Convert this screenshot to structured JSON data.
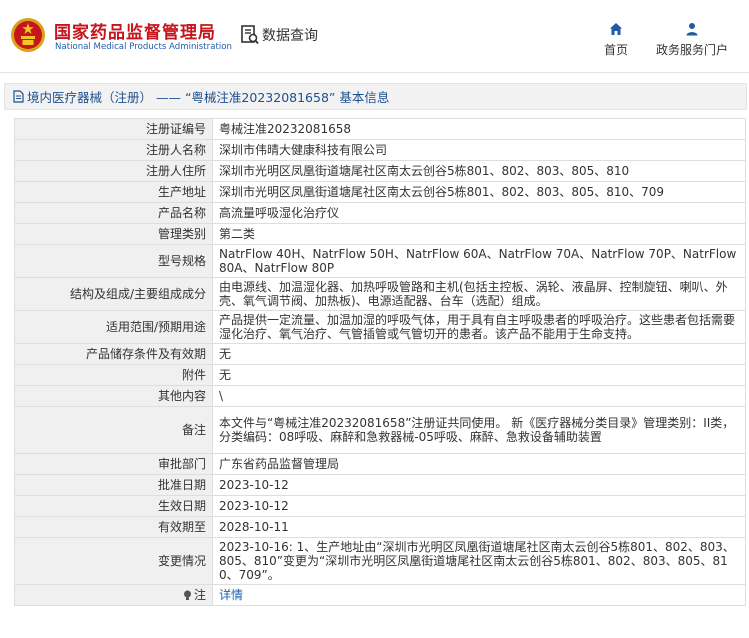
{
  "header": {
    "brand_cn": "国家药品监督管理局",
    "brand_en": "National Medical Products Administration",
    "query_label": "数据查询",
    "nav_home": "首页",
    "nav_service": "政务服务门户"
  },
  "breadcrumb": {
    "text": "境内医疗器械（注册） —— “粤械注准20232081658” 基本信息"
  },
  "record": {
    "rows": [
      {
        "label": "注册证编号",
        "value": "粤械注准20232081658"
      },
      {
        "label": "注册人名称",
        "value": "深圳市伟晴大健康科技有限公司"
      },
      {
        "label": "注册人住所",
        "value": "深圳市光明区凤凰街道塘尾社区南太云创谷5栋801、802、803、805、810"
      },
      {
        "label": "生产地址",
        "value": "深圳市光明区凤凰街道塘尾社区南太云创谷5栋801、802、803、805、810、709"
      },
      {
        "label": "产品名称",
        "value": "高流量呼吸湿化治疗仪"
      },
      {
        "label": "管理类别",
        "value": "第二类"
      },
      {
        "label": "型号规格",
        "value": "NatrFlow 40H、NatrFlow 50H、NatrFlow 60A、NatrFlow 70A、NatrFlow 70P、NatrFlow 80A、NatrFlow 80P"
      },
      {
        "label": "结构及组成/主要组成成分",
        "value": "由电源线、加温湿化器、加热呼吸管路和主机(包括主控板、涡轮、液晶屏、控制旋钮、喇叭、外壳、氧气调节阀、加热板)、电源适配器、台车（选配）组成。"
      },
      {
        "label": "适用范围/预期用途",
        "value": "产品提供一定流量、加温加湿的呼吸气体，用于具有自主呼吸患者的呼吸治疗。这些患者包括需要湿化治疗、氧气治疗、气管插管或气管切开的患者。该产品不能用于生命支持。"
      },
      {
        "label": "产品储存条件及有效期",
        "value": "无"
      },
      {
        "label": "附件",
        "value": "无"
      },
      {
        "label": "其他内容",
        "value": "\\"
      },
      {
        "label": "备注",
        "value": "本文件与“粤械注准20232081658”注册证共同使用。 新《医疗器械分类目录》管理类别：II类，分类编码：08呼吸、麻醉和急救器械-05呼吸、麻醉、急救设备辅助装置"
      },
      {
        "label": "审批部门",
        "value": "广东省药品监督管理局"
      },
      {
        "label": "批准日期",
        "value": "2023-10-12"
      },
      {
        "label": "生效日期",
        "value": "2023-10-12"
      },
      {
        "label": "有效期至",
        "value": "2028-10-11"
      },
      {
        "label": "变更情况",
        "value": "2023-10-16: 1、生产地址由“深圳市光明区凤凰街道塘尾社区南太云创谷5栋801、802、803、805、810”变更为“深圳市光明区凤凰街道塘尾社区南太云创谷5栋801、802、803、805、810、709”。"
      },
      {
        "label": "注",
        "value": "详情"
      }
    ]
  },
  "colors": {
    "brand_red": "#c4161c",
    "brand_blue": "#1f5fa8",
    "link_blue": "#1e62b0",
    "label_bg": "#f0f0f0"
  },
  "icons": {
    "logo": "national-emblem-icon",
    "query": "document-search-icon",
    "home": "home-icon",
    "service": "user-icon",
    "breadcrumb": "document-icon",
    "note": "lightbulb-icon"
  }
}
